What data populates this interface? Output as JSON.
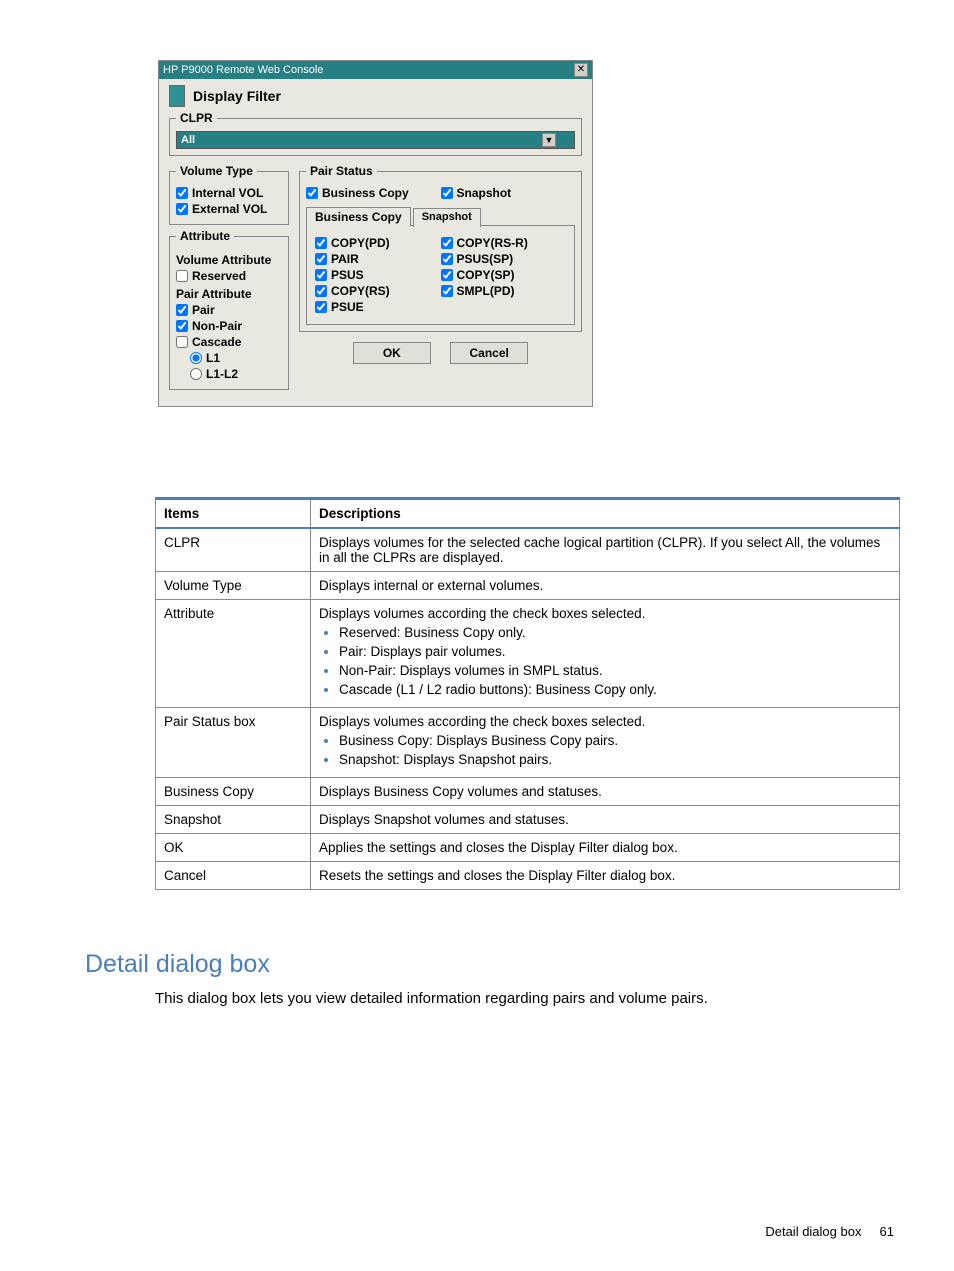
{
  "dialog": {
    "title": "HP P9000 Remote Web Console",
    "heading": "Display Filter",
    "clpr": {
      "legend": "CLPR",
      "value": "All"
    },
    "volumeType": {
      "legend": "Volume Type",
      "internal": "Internal VOL",
      "external": "External VOL"
    },
    "attribute": {
      "legend": "Attribute",
      "volAttr": "Volume Attribute",
      "reserved": "Reserved",
      "pairAttr": "Pair Attribute",
      "pair": "Pair",
      "nonPair": "Non-Pair",
      "cascade": "Cascade",
      "l1": "L1",
      "l1l2": "L1-L2"
    },
    "pairStatus": {
      "legend": "Pair Status",
      "businessCopy": "Business Copy",
      "snapshot": "Snapshot",
      "tabBC": "Business Copy",
      "tabSS": "Snapshot",
      "left": [
        "COPY(PD)",
        "PAIR",
        "PSUS",
        "COPY(RS)",
        "PSUE"
      ],
      "right": [
        "COPY(RS-R)",
        "PSUS(SP)",
        "COPY(SP)",
        "SMPL(PD)"
      ]
    },
    "ok": "OK",
    "cancel": "Cancel"
  },
  "table": {
    "headers": {
      "items": "Items",
      "desc": "Descriptions"
    },
    "rows": [
      {
        "item": "CLPR",
        "desc": "Displays volumes for the selected cache logical partition (CLPR). If you select All, the volumes in all the CLPRs are displayed."
      },
      {
        "item": "Volume Type",
        "desc": "Displays internal or external volumes."
      },
      {
        "item": "Attribute",
        "desc": "Displays volumes according the check boxes selected.",
        "bullets": [
          "Reserved: Business Copy only.",
          "Pair: Displays pair volumes.",
          "Non-Pair: Displays volumes in SMPL status.",
          "Cascade (L1 / L2 radio buttons): Business Copy only."
        ]
      },
      {
        "item": "Pair Status box",
        "desc": "Displays volumes according the check boxes selected.",
        "bullets": [
          "Business Copy: Displays Business Copy pairs.",
          "Snapshot: Displays Snapshot pairs."
        ]
      },
      {
        "item": "Business Copy",
        "desc": "Displays Business Copy volumes and statuses."
      },
      {
        "item": "Snapshot",
        "desc": "Displays Snapshot volumes and statuses."
      },
      {
        "item": "OK",
        "desc": "Applies the settings and closes the Display Filter dialog box."
      },
      {
        "item": "Cancel",
        "desc": "Resets the settings and closes the Display Filter dialog box."
      }
    ]
  },
  "section": {
    "heading": "Detail dialog box",
    "text": "This dialog box lets you view detailed information regarding pairs and volume pairs."
  },
  "footer": {
    "text": "Detail dialog box",
    "page": "61"
  }
}
